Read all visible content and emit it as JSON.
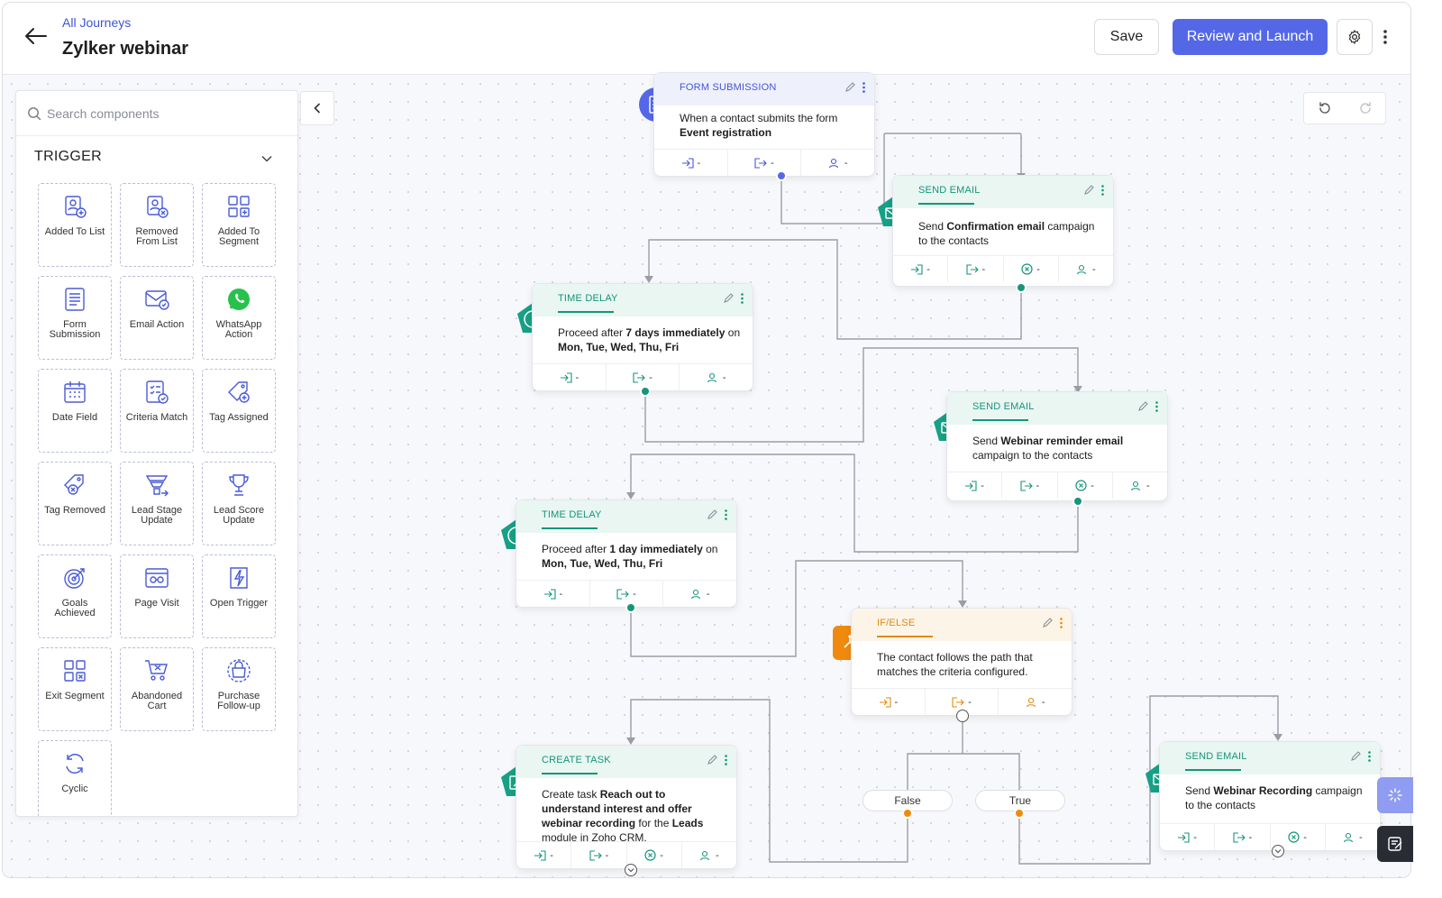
{
  "header": {
    "breadcrumb": "All Journeys",
    "title": "Zylker webinar",
    "save_label": "Save",
    "launch_label": "Review and Launch"
  },
  "sidebar": {
    "search_placeholder": "Search components",
    "section_label": "TRIGGER",
    "items": [
      {
        "label": "Added To List",
        "icon": "added-to-list-icon"
      },
      {
        "label": "Removed From List",
        "icon": "removed-from-list-icon"
      },
      {
        "label": "Added To Segment",
        "icon": "added-to-segment-icon"
      },
      {
        "label": "Form Submission",
        "icon": "form-icon"
      },
      {
        "label": "Email Action",
        "icon": "email-action-icon"
      },
      {
        "label": "WhatsApp Action",
        "icon": "whatsapp-icon"
      },
      {
        "label": "Date Field",
        "icon": "calendar-icon"
      },
      {
        "label": "Criteria Match",
        "icon": "criteria-icon"
      },
      {
        "label": "Tag Assigned",
        "icon": "tag-add-icon"
      },
      {
        "label": "Tag Removed",
        "icon": "tag-remove-icon"
      },
      {
        "label": "Lead Stage Update",
        "icon": "funnel-icon"
      },
      {
        "label": "Lead Score Update",
        "icon": "trophy-icon"
      },
      {
        "label": "Goals Achieved",
        "icon": "target-icon"
      },
      {
        "label": "Page Visit",
        "icon": "page-visit-icon"
      },
      {
        "label": "Open Trigger",
        "icon": "lightning-icon"
      },
      {
        "label": "Exit Segment",
        "icon": "exit-segment-icon"
      },
      {
        "label": "Abandoned Cart",
        "icon": "cart-icon"
      },
      {
        "label": "Purchase Follow-up",
        "icon": "bag-icon"
      },
      {
        "label": "Cyclic",
        "icon": "cycle-icon"
      }
    ]
  },
  "nodes": {
    "form": {
      "title": "FORM SUBMISSION",
      "body_pre": "When a contact submits the form ",
      "body_bold": "Event registration",
      "f1": "-",
      "f2": "-",
      "f3": "-"
    },
    "email1": {
      "title": "SEND EMAIL",
      "body_pre": "Send ",
      "body_bold": "Confirmation email",
      "body_post": " campaign to the contacts",
      "f1": "-",
      "f2": "-",
      "f3": "-",
      "f4": "-"
    },
    "delay1": {
      "title": "TIME DELAY",
      "body_pre": "Proceed after ",
      "body_bold": "7 days immediately",
      "body_post": " on ",
      "body_bold2": "Mon, Tue, Wed, Thu, Fri",
      "f1": "-",
      "f2": "-",
      "f3": "-"
    },
    "email2": {
      "title": "SEND EMAIL",
      "body_pre": "Send ",
      "body_bold": "Webinar reminder email",
      "body_post": " campaign to the contacts",
      "f1": "-",
      "f2": "-",
      "f3": "-",
      "f4": "-"
    },
    "delay2": {
      "title": "TIME DELAY",
      "body_pre": "Proceed after ",
      "body_bold": "1 day immediately",
      "body_post": " on ",
      "body_bold2": "Mon, Tue, Wed, Thu, Fri",
      "f1": "-",
      "f2": "-",
      "f3": "-"
    },
    "ifelse": {
      "title": "IF/ELSE",
      "body": "The contact follows the path that matches the criteria configured.",
      "f1": "-",
      "f2": "-",
      "f3": "-"
    },
    "task": {
      "title": "CREATE TASK",
      "body_pre": "Create task ",
      "body_bold": "Reach out to understand interest and offer webinar recording",
      "body_post": " for the ",
      "body_bold2": "Leads",
      "body_post2": " module in Zoho CRM.",
      "f1": "-",
      "f2": "-",
      "f3": "-",
      "f4": "-"
    },
    "email3": {
      "title": "SEND EMAIL",
      "body_pre": "Send ",
      "body_bold": "Webinar Recording",
      "body_post": " campaign to the contacts",
      "f1": "-",
      "f2": "-",
      "f3": "-",
      "f4": "-"
    }
  },
  "branches": {
    "false_label": "False",
    "true_label": "True"
  },
  "colors": {
    "accent": "#5468e7",
    "green": "#16957a",
    "orange": "#e08a12",
    "blue": "#4556d4"
  }
}
